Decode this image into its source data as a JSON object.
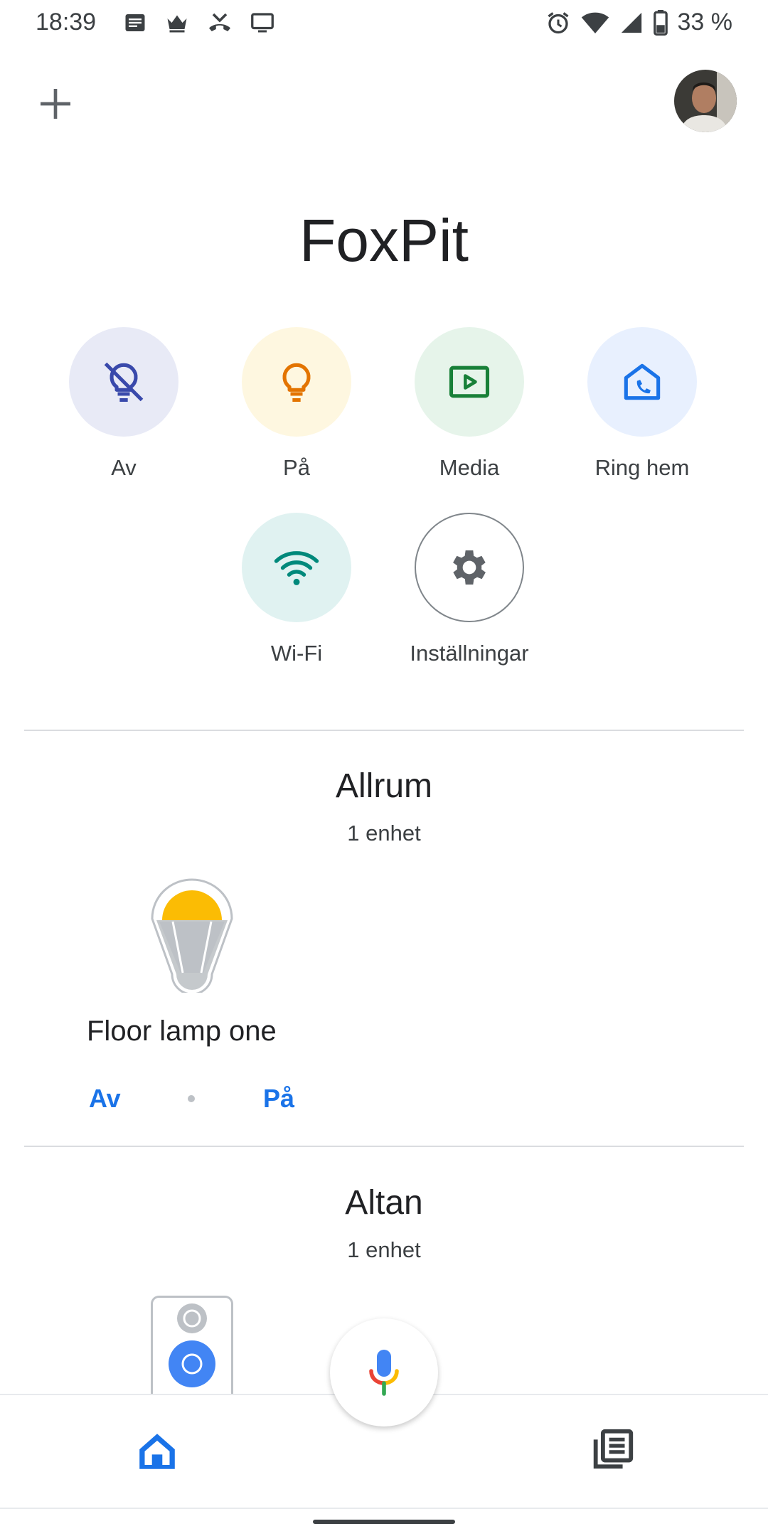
{
  "status_bar": {
    "time": "18:39",
    "battery": "33 %",
    "left_icons": [
      "news-icon",
      "crown-icon",
      "missed-call-icon",
      "cast-screen-icon"
    ],
    "right_icons": [
      "alarm-icon",
      "wifi-icon",
      "signal-icon",
      "battery-icon"
    ]
  },
  "home": {
    "title": "FoxPit"
  },
  "actions": [
    {
      "label": "Av",
      "icon": "lightbulb-off-icon",
      "bg": "#e8eaf6",
      "color": "#3949ab"
    },
    {
      "label": "På",
      "icon": "lightbulb-on-icon",
      "bg": "#fef7e0",
      "color": "#e37400"
    },
    {
      "label": "Media",
      "icon": "play-media-icon",
      "bg": "#e6f4ea",
      "color": "#188038"
    },
    {
      "label": "Ring hem",
      "icon": "call-home-icon",
      "bg": "#e8f0fe",
      "color": "#1a73e8"
    },
    {
      "label": "Wi-Fi",
      "icon": "wifi-icon",
      "bg": "#e0f2f1",
      "color": "#00897b"
    },
    {
      "label": "Inställningar",
      "icon": "settings-gear-icon",
      "bg": "#ffffff",
      "color": "#5f6368"
    }
  ],
  "rooms": [
    {
      "name": "Allrum",
      "device_count": "1 enhet",
      "devices": [
        {
          "name": "Floor lamp one",
          "icon": "bulb-device-icon",
          "off_label": "Av",
          "on_label": "På"
        }
      ]
    },
    {
      "name": "Altan",
      "device_count": "1 enhet",
      "devices": [
        {
          "icon": "speaker-device-icon"
        }
      ]
    }
  ],
  "bottom_nav": {
    "home_icon": "home-icon",
    "feed_icon": "feed-icon",
    "mic_icon": "microphone-icon"
  },
  "colors": {
    "accent": "#1a73e8",
    "divider": "#dadce0"
  }
}
